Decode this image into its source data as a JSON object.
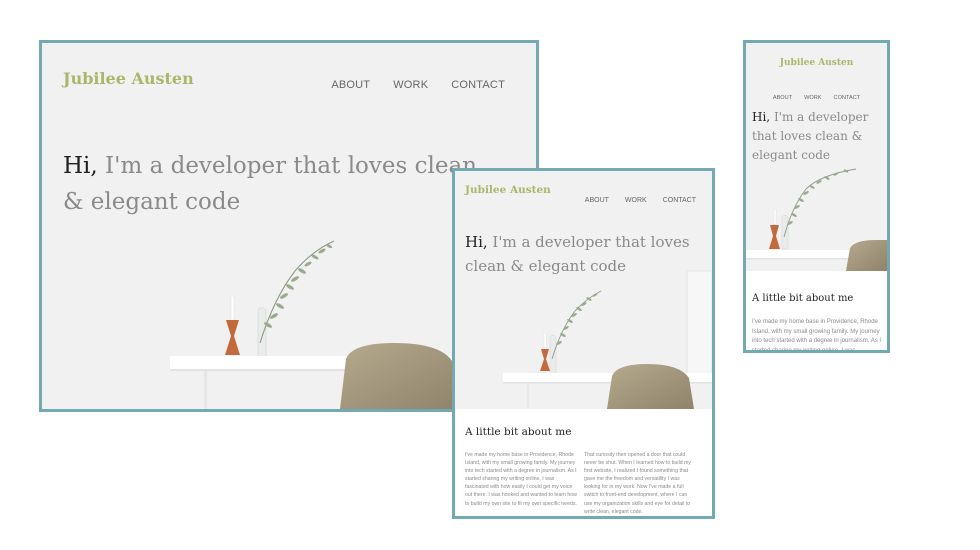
{
  "site": {
    "logo": "Jubilee Austen",
    "nav": [
      "ABOUT",
      "WORK",
      "CONTACT"
    ],
    "hero": {
      "greeting": "Hi,",
      "tagline": " I'm a developer that loves clean & elegant code"
    },
    "about": {
      "title": "A little bit about me",
      "paragraph_1": "I've made my home base in Providence, Rhode Island, with my small growing family. My journey into tech started with a degree in journalism. As I started sharing my writing online, I was fascinated with how easily I could get my voice out there. I was hooked and wanted to learn how to build my own site to fit my own specific needs.",
      "paragraph_2": "That curiosity then opened a door that could never be shut. When I learned how to build my first website, I realized I found something that gave me the freedom and versatility I was looking for in my work. Now I've made a full switch to front-end development, where I can use my organization skills and eye for detail to write clean, elegant code."
    }
  },
  "colors": {
    "frame_border": "#73aab2",
    "logo": "#a9b76b",
    "hero_bg": "#f1f1f1",
    "headline_dark": "#222222",
    "headline_muted": "#8a8a8a",
    "body_text": "#8a8a8a"
  },
  "icons": [
    "plant-vase-illustration",
    "candle-holder-illustration",
    "chair-illustration",
    "desk-illustration"
  ]
}
